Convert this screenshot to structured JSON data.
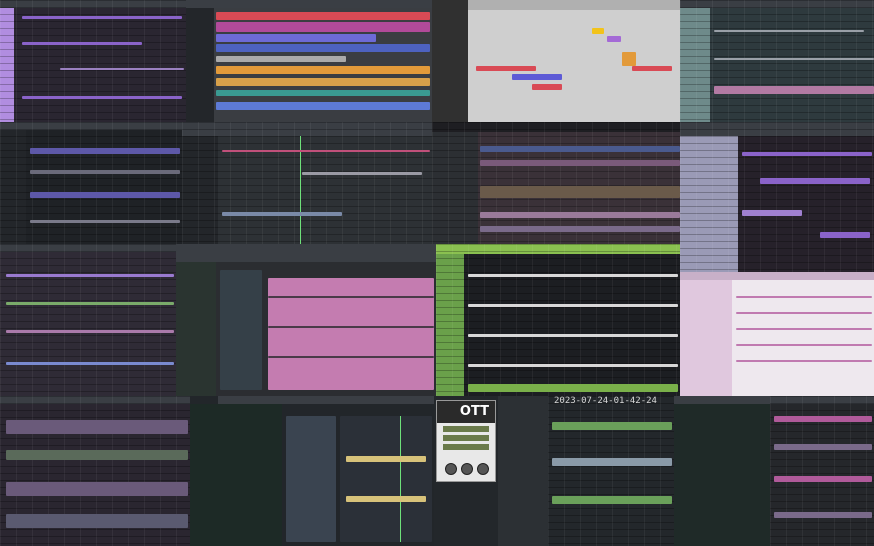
{
  "collage": {
    "timestamp": "2023-07-24-01-42-24",
    "plugin_name": "OTT",
    "accent_colors": {
      "purple": "#8a63c9",
      "pink": "#d77ab0",
      "red": "#d94a55",
      "blue": "#5d7ad6",
      "orange": "#e29a3a",
      "teal": "#3a9a92",
      "green": "#7ab04a",
      "lightblue": "#8fc7ee"
    },
    "icons": [
      "playhead-icon",
      "knob-icon",
      "record-circle-icon"
    ]
  }
}
